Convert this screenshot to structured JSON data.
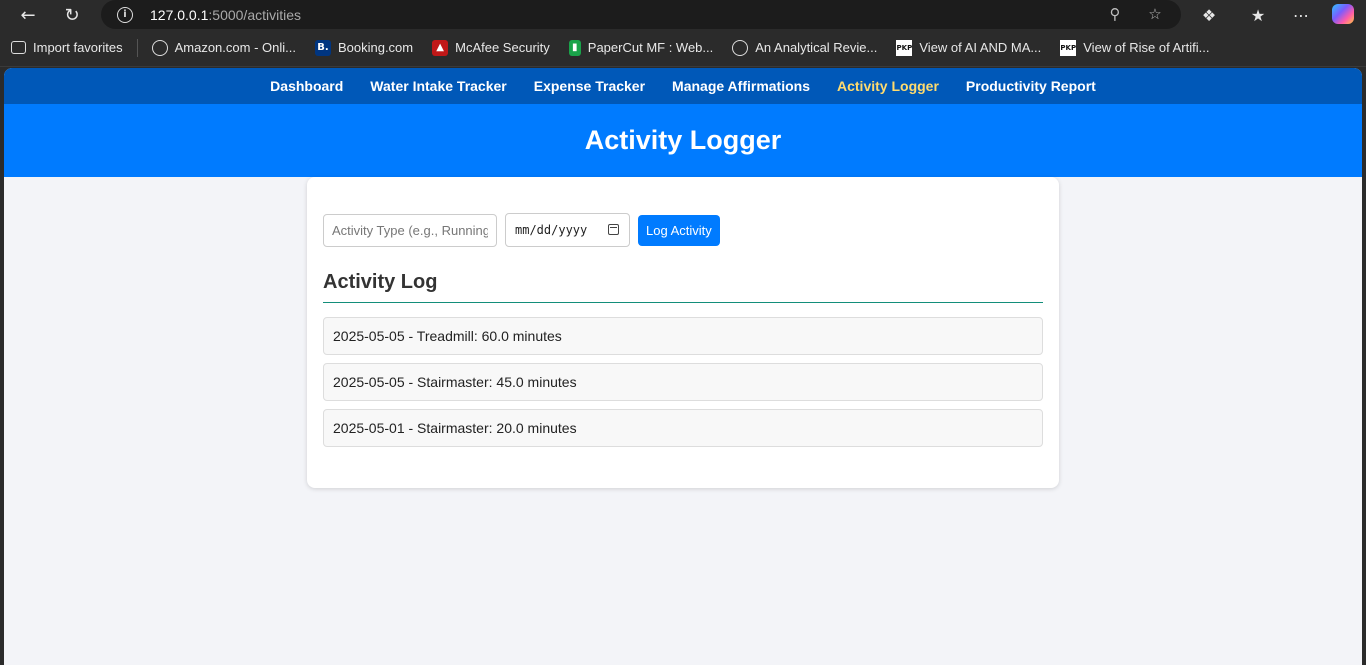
{
  "browser": {
    "url_host": "127.0.0.1",
    "url_rest": ":5000/activities",
    "bookmarks": [
      {
        "label": "Import favorites",
        "icon": "import-icon"
      },
      {
        "label": "Amazon.com - Onli...",
        "icon": "globe-icon"
      },
      {
        "label": "Booking.com",
        "icon": "booking-icon",
        "glyph": "B."
      },
      {
        "label": "McAfee Security",
        "icon": "mcafee-icon"
      },
      {
        "label": "PaperCut MF : Web...",
        "icon": "papercut-icon"
      },
      {
        "label": "An Analytical Revie...",
        "icon": "globe-icon"
      },
      {
        "label": "View of AI AND MA...",
        "icon": "pkp-icon",
        "glyph": "PKP"
      },
      {
        "label": "View of Rise of Artifi...",
        "icon": "pkp-icon",
        "glyph": "PKP"
      }
    ]
  },
  "nav": {
    "items": [
      "Dashboard",
      "Water Intake Tracker",
      "Expense Tracker",
      "Manage Affirmations",
      "Activity Logger",
      "Productivity Report"
    ],
    "active": "Activity Logger"
  },
  "header": {
    "title": "Activity Logger"
  },
  "form": {
    "activity_placeholder": "Activity Type (e.g., Running",
    "date_placeholder": "mm/dd/yyyy",
    "submit_label": "Log Activity"
  },
  "log": {
    "title": "Activity Log",
    "entries": [
      "2025-05-05 - Treadmill: 60.0 minutes",
      "2025-05-05 - Stairmaster: 45.0 minutes",
      "2025-05-01 - Stairmaster: 20.0 minutes"
    ]
  },
  "colors": {
    "nav_bg": "#0058b8",
    "header_bg": "#007bff",
    "active_nav": "#ffdb6e",
    "rule": "#138e7a"
  }
}
